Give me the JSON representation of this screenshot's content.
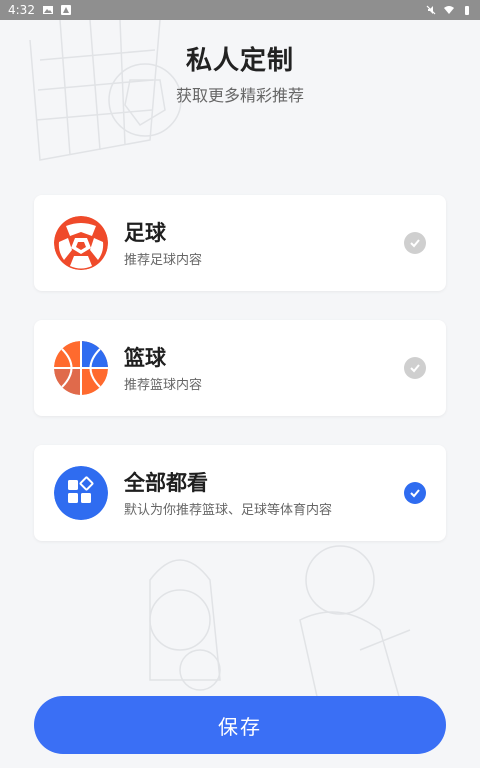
{
  "status_bar": {
    "time": "4:32"
  },
  "header": {
    "title": "私人定制",
    "subtitle": "获取更多精彩推荐"
  },
  "options": [
    {
      "name": "足球",
      "desc": "推荐足球内容",
      "selected": false,
      "icon": "football-icon"
    },
    {
      "name": "篮球",
      "desc": "推荐篮球内容",
      "selected": false,
      "icon": "basketball-icon"
    },
    {
      "name": "全部都看",
      "desc": "默认为你推荐篮球、足球等体育内容",
      "selected": true,
      "icon": "grid-apps-icon"
    }
  ],
  "save_button": {
    "label": "保存"
  },
  "colors": {
    "accent": "#3a6ff5",
    "football_red": "#ef4a2a",
    "basket_orange": "#ff6a2e",
    "check_off": "#cfcfcf"
  }
}
